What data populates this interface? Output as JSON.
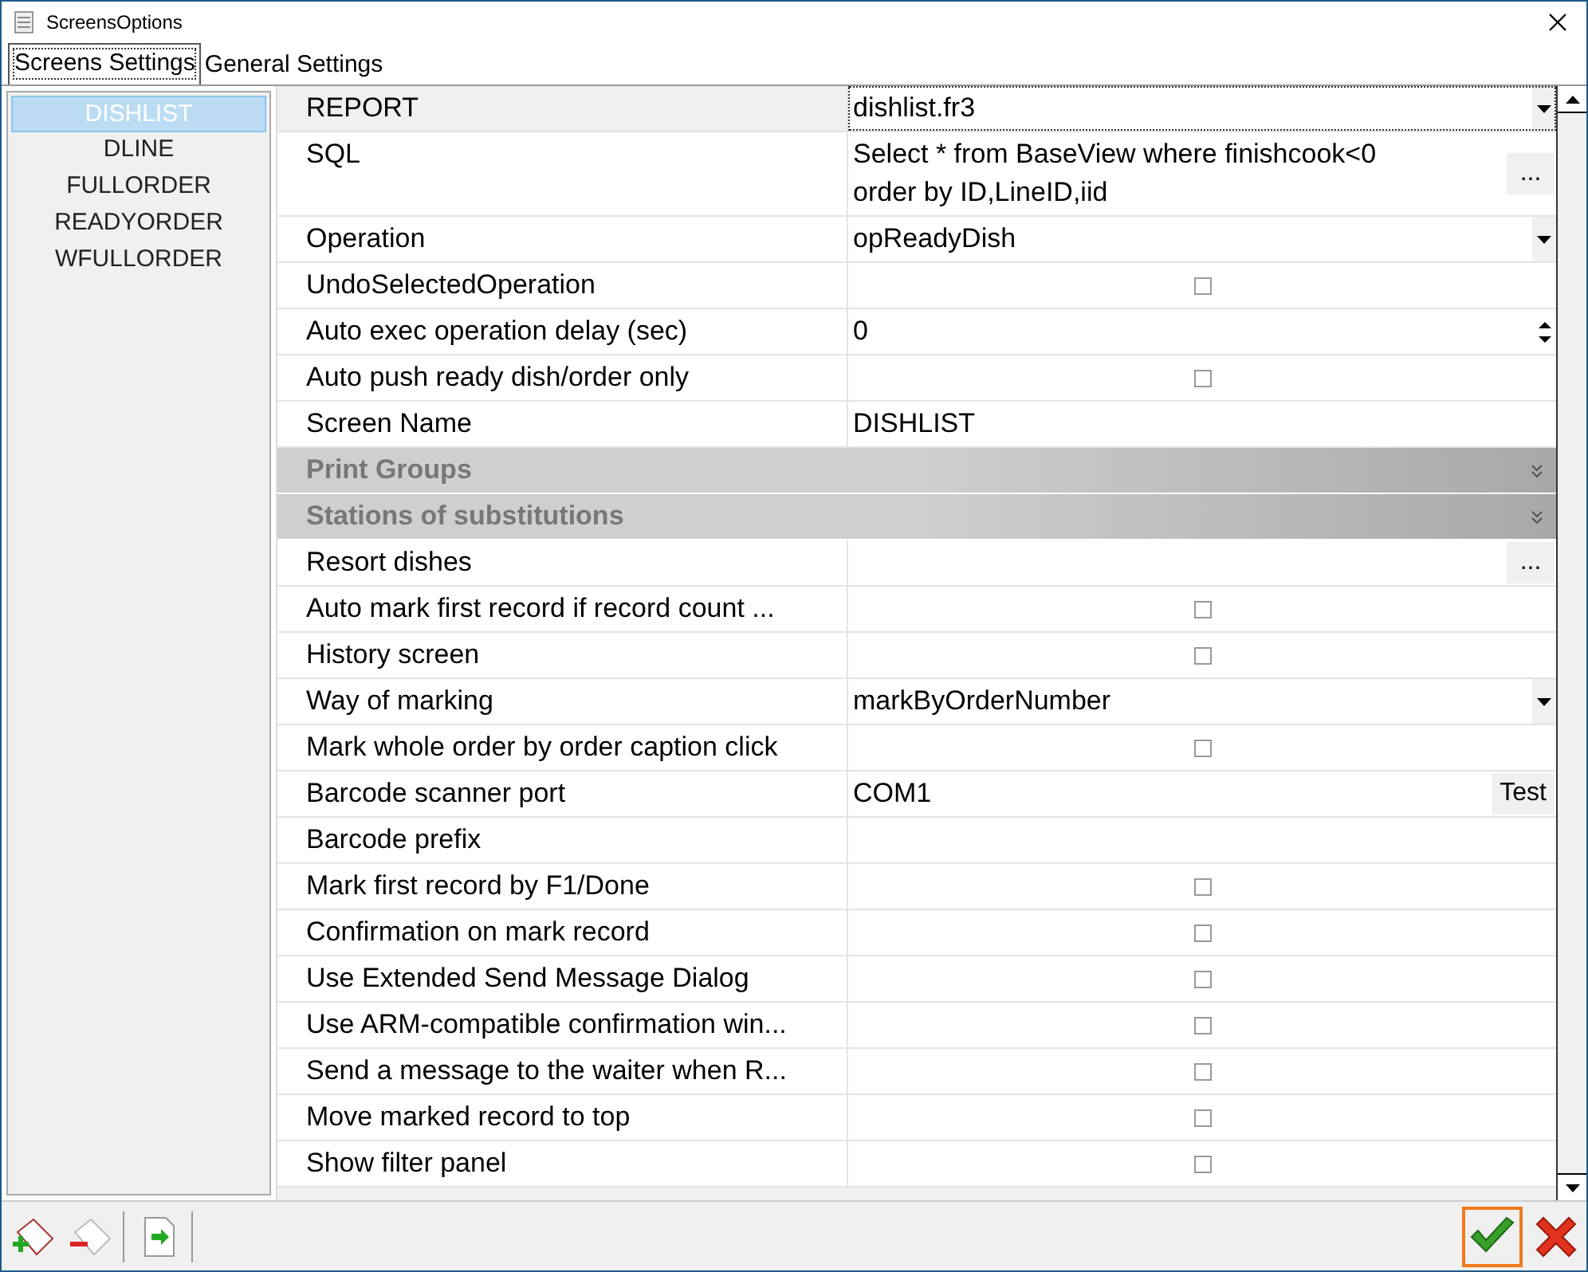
{
  "window": {
    "title": "ScreensOptions"
  },
  "tabs": [
    {
      "label": "Screens Settings",
      "selected": true
    },
    {
      "label": "General Settings",
      "selected": false
    }
  ],
  "screens": [
    {
      "label": "DISHLIST",
      "selected": true
    },
    {
      "label": "DLINE",
      "selected": false
    },
    {
      "label": "FULLORDER",
      "selected": false
    },
    {
      "label": "READYORDER",
      "selected": false
    },
    {
      "label": "WFULLORDER",
      "selected": false
    }
  ],
  "properties": [
    {
      "kind": "combo",
      "label": "REPORT",
      "value": "dishlist.fr3",
      "selected": true
    },
    {
      "kind": "memo",
      "label": "SQL",
      "value": "Select * from BaseView where finishcook<0 order by ID,LineID,iid",
      "button": "...",
      "selected": false
    },
    {
      "kind": "combo",
      "label": "Operation",
      "value": "opReadyDish",
      "selected": false
    },
    {
      "kind": "check",
      "label": "UndoSelectedOperation",
      "checked": false,
      "selected": false
    },
    {
      "kind": "spin",
      "label": "Auto exec operation delay (sec)",
      "value": "0",
      "selected": false
    },
    {
      "kind": "check",
      "label": "Auto push ready dish/order only",
      "checked": false,
      "selected": false
    },
    {
      "kind": "text",
      "label": "Screen Name",
      "value": "DISHLIST",
      "selected": false
    },
    {
      "kind": "group",
      "label": "Print Groups"
    },
    {
      "kind": "group",
      "label": "Stations of substitutions"
    },
    {
      "kind": "ellipsis",
      "label": "Resort dishes",
      "button": "...",
      "selected": false
    },
    {
      "kind": "check",
      "label": "Auto mark first record if record count ...",
      "checked": false,
      "selected": false
    },
    {
      "kind": "check",
      "label": "History screen",
      "checked": false,
      "selected": false
    },
    {
      "kind": "combo",
      "label": "Way of marking",
      "value": "markByOrderNumber",
      "selected": false
    },
    {
      "kind": "check",
      "label": "Mark whole order by order caption click",
      "checked": false,
      "selected": false
    },
    {
      "kind": "ellipsis",
      "label": "Barcode scanner port",
      "value": "COM1",
      "button": "Test",
      "selected": false
    },
    {
      "kind": "text",
      "label": "Barcode prefix",
      "selected": false
    },
    {
      "kind": "check",
      "label": "Mark first record by F1/Done",
      "checked": false,
      "selected": false
    },
    {
      "kind": "check",
      "label": "Confirmation on mark record",
      "checked": false,
      "selected": false
    },
    {
      "kind": "check",
      "label": "Use Extended Send Message Dialog",
      "checked": false,
      "selected": false
    },
    {
      "kind": "check",
      "label": "Use ARM-compatible confirmation win...",
      "checked": false,
      "selected": false
    },
    {
      "kind": "check",
      "label": "Send a message to the waiter when R...",
      "checked": false,
      "selected": false
    },
    {
      "kind": "check",
      "label": "Move marked record to top",
      "checked": false,
      "selected": false
    },
    {
      "kind": "check",
      "label": "Show filter panel",
      "checked": false,
      "selected": false
    }
  ]
}
